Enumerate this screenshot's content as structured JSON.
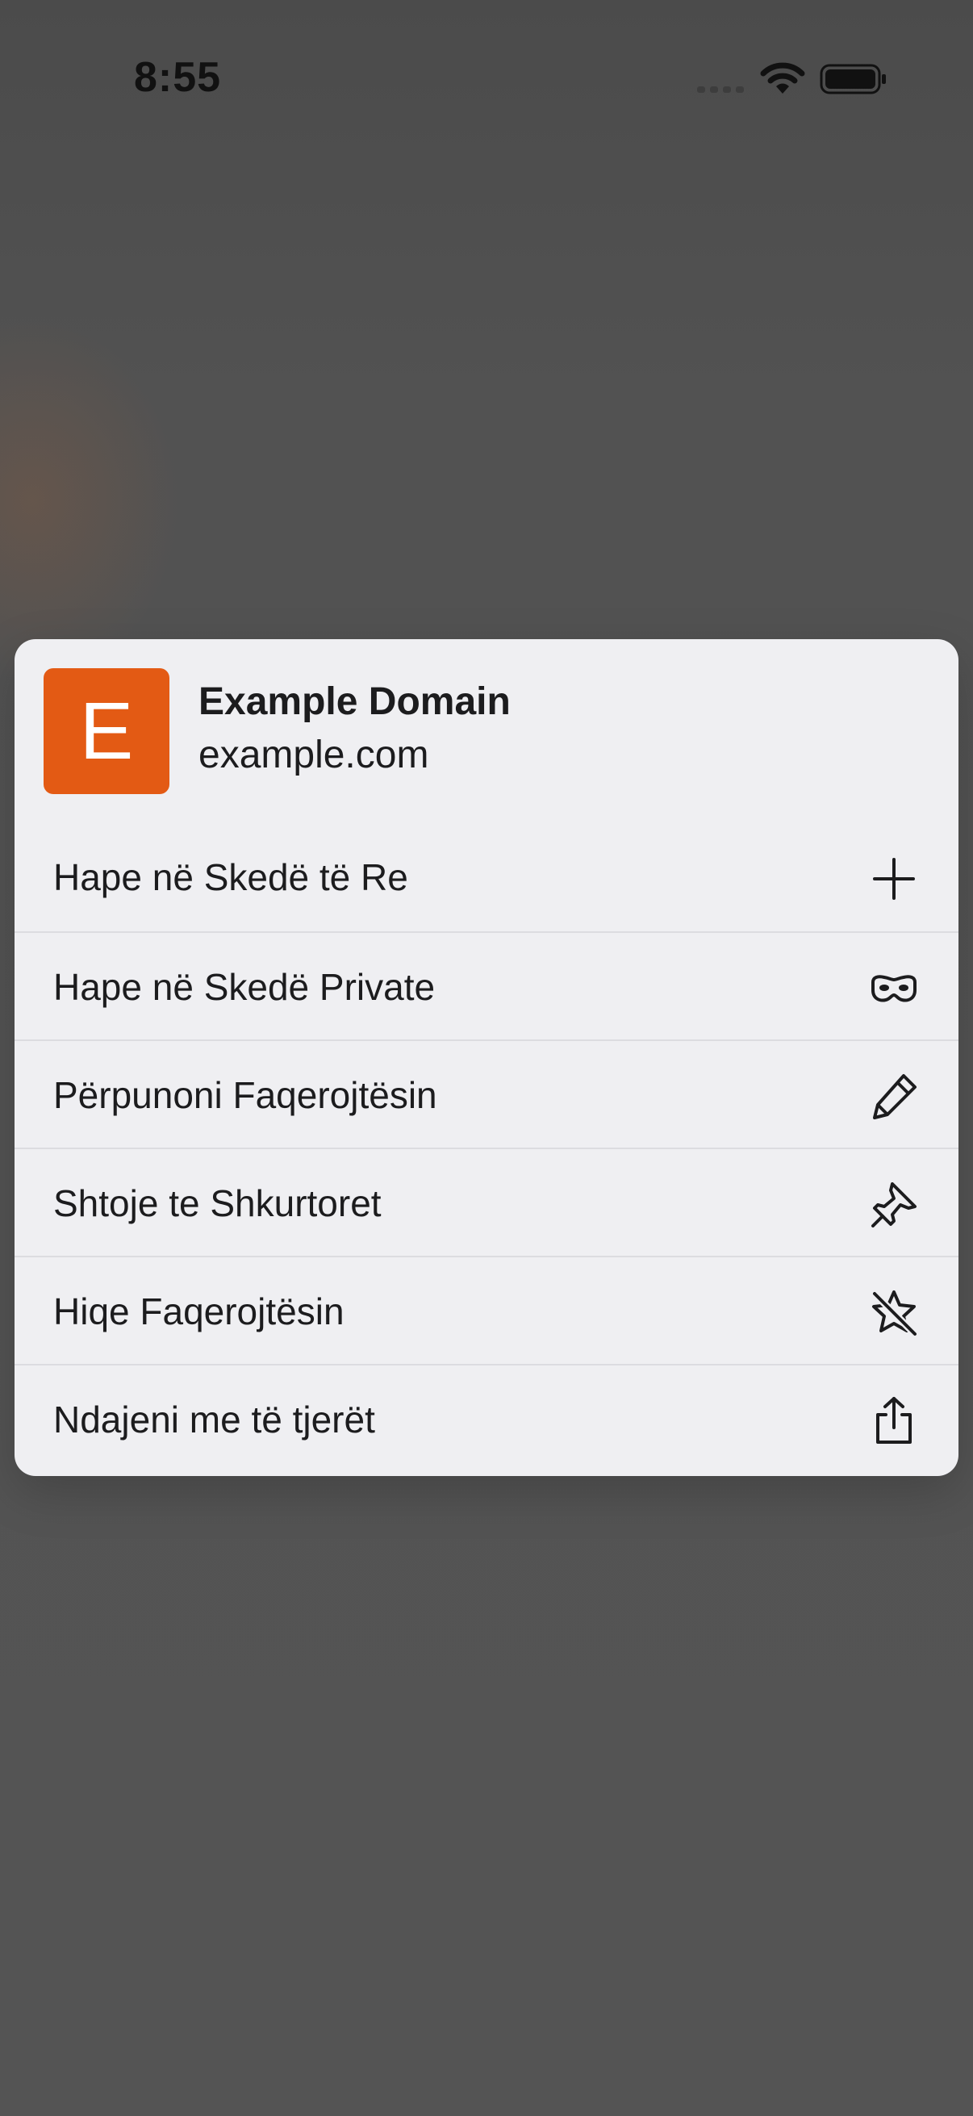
{
  "status_bar": {
    "time": "8:55",
    "signal_icon": "cellular-signal-dots-icon",
    "wifi_icon": "wifi-icon",
    "battery_icon": "battery-icon"
  },
  "preview": {
    "tile_letter": "E",
    "tile_color": "#e35a14",
    "title": "Example Domain",
    "url": "example.com"
  },
  "menu": {
    "items": [
      {
        "label": "Hape në Skedë të Re",
        "icon": "plus-icon"
      },
      {
        "label": "Hape në Skedë Private",
        "icon": "private-mask-icon"
      },
      {
        "label": "Përpunoni Faqerojtësin",
        "icon": "pencil-icon"
      },
      {
        "label": "Shtoje te Shkurtoret",
        "icon": "pin-icon"
      },
      {
        "label": "Hiqe Faqerojtësin",
        "icon": "star-slash-icon"
      },
      {
        "label": "Ndajeni me të tjerët",
        "icon": "share-icon"
      }
    ]
  }
}
